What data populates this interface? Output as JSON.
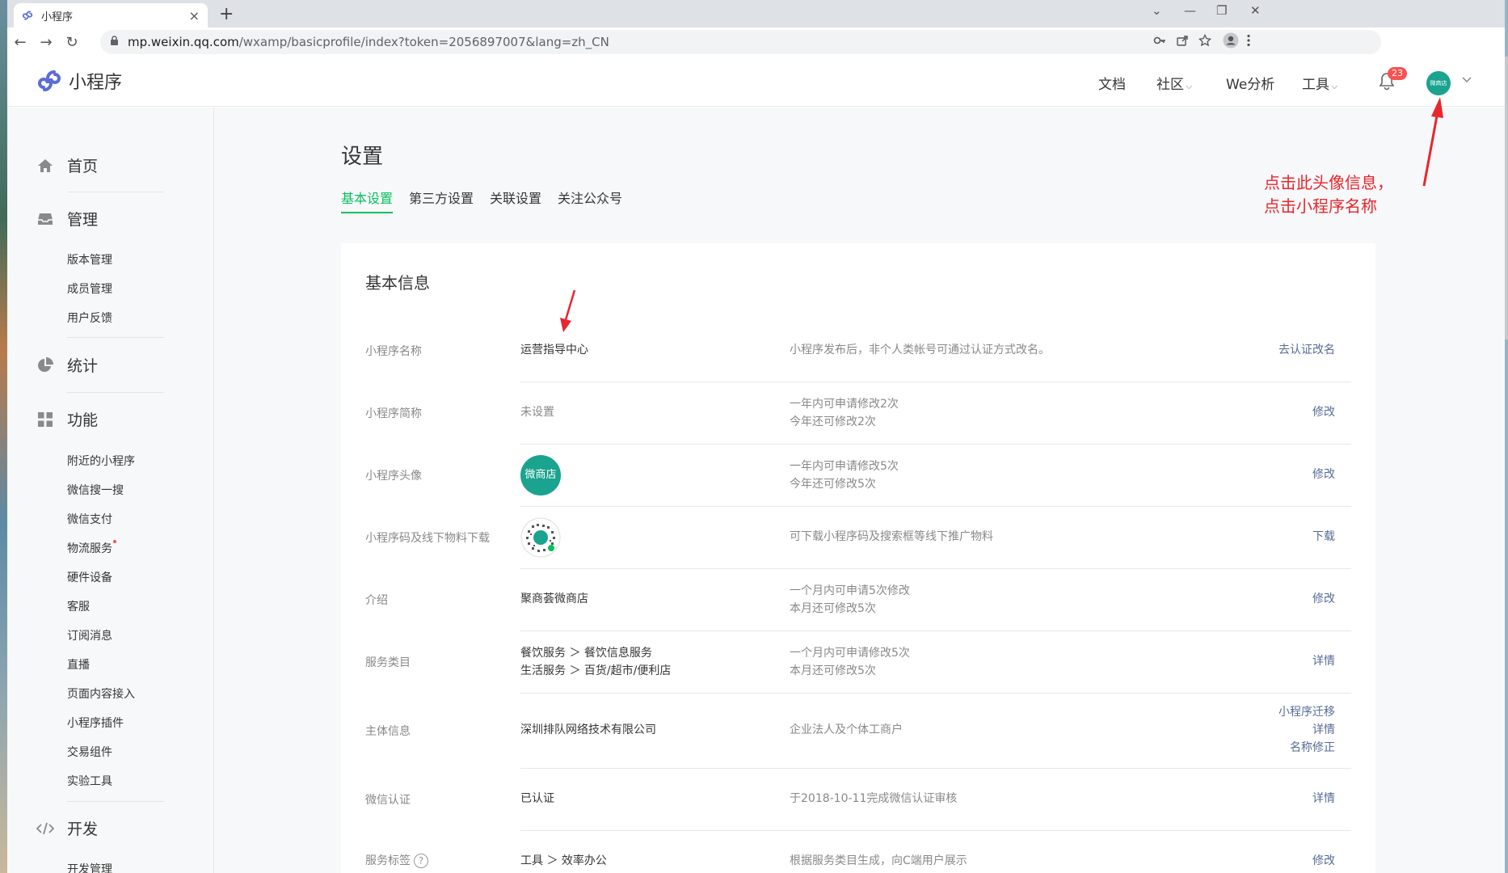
{
  "browser": {
    "tab_title": "小程序",
    "tab_close": "×",
    "new_tab": "+",
    "url_host": "mp.weixin.qq.com",
    "url_path": "/wxamp/basicprofile/index?token=2056897007&lang=zh_CN",
    "window_controls": [
      "⌄",
      "—",
      "❐",
      "✕"
    ],
    "nav": {
      "back": "←",
      "forward": "→",
      "reload": "↻"
    }
  },
  "header": {
    "logo_text": "小程序",
    "nav": [
      {
        "label": "文档"
      },
      {
        "label": "社区",
        "caret": "⌵"
      },
      {
        "label": "We分析"
      },
      {
        "label": "工具",
        "caret": "⌵"
      }
    ],
    "notification_count": "23",
    "avatar_text": "微商店"
  },
  "sidebar": {
    "sections": [
      {
        "label": "首页",
        "icon": "home-icon"
      },
      {
        "label": "管理",
        "icon": "inbox-icon",
        "items": [
          "版本管理",
          "成员管理",
          "用户反馈"
        ]
      },
      {
        "label": "统计",
        "icon": "pie-chart-icon"
      },
      {
        "label": "功能",
        "icon": "grid-icon",
        "items": [
          "附近的小程序",
          "微信搜一搜",
          "微信支付",
          "物流服务",
          "硬件设备",
          "客服",
          "订阅消息",
          "直播",
          "页面内容接入",
          "小程序插件",
          "交易组件",
          "实验工具"
        ]
      },
      {
        "label": "开发",
        "icon": "code-icon",
        "items": [
          "开发管理"
        ]
      }
    ]
  },
  "main": {
    "title": "设置",
    "tabs": [
      {
        "label": "基本设置",
        "active": true
      },
      {
        "label": "第三方设置"
      },
      {
        "label": "关联设置"
      },
      {
        "label": "关注公众号"
      }
    ],
    "card_title": "基本信息",
    "rows": [
      {
        "label": "小程序名称",
        "value": "运营指导中心",
        "desc": [
          "小程序发布后，非个人类帐号可通过认证方式改名。"
        ],
        "actions": [
          "去认证改名"
        ]
      },
      {
        "label": "小程序简称",
        "value": "未设置",
        "desc": [
          "一年内可申请修改2次",
          "今年还可修改2次"
        ],
        "actions": [
          "修改"
        ]
      },
      {
        "label": "小程序头像",
        "value_avatar": "微商店",
        "desc": [
          "一年内可申请修改5次",
          "今年还可修改5次"
        ],
        "actions": [
          "修改"
        ]
      },
      {
        "label": "小程序码及线下物料下载",
        "desc": [
          "可下载小程序码及搜索框等线下推广物料"
        ],
        "actions": [
          "下载"
        ]
      },
      {
        "label": "介绍",
        "value": "聚商荟微商店",
        "desc": [
          "一个月内可申请5次修改",
          "本月还可修改5次"
        ],
        "actions": [
          "修改"
        ]
      },
      {
        "label": "服务类目",
        "value_lines": [
          "餐饮服务 ＞ 餐饮信息服务",
          "生活服务 ＞ 百货/超市/便利店"
        ],
        "desc": [
          "一个月内可申请修改5次",
          "本月还可修改5次"
        ],
        "actions": [
          "详情"
        ]
      },
      {
        "label": "主体信息",
        "value": "深圳排队网络技术有限公司",
        "desc": [
          "企业法人及个体工商户"
        ],
        "actions": [
          "小程序迁移",
          "详情",
          "名称修正"
        ]
      },
      {
        "label": "微信认证",
        "value": "已认证",
        "desc": [
          "于2018-10-11完成微信认证审核"
        ],
        "actions": [
          "详情"
        ]
      },
      {
        "label": "服务标签",
        "value": "工具 ＞ 效率办公",
        "desc": [
          "根据服务类目生成，向C端用户展示"
        ],
        "actions": [
          "修改"
        ]
      }
    ]
  },
  "annotation": {
    "lines": [
      "点击此头像信息，",
      "点击小程序名称"
    ],
    "color": "#e8262d"
  },
  "colors": {
    "accent": "#07c160",
    "link": "#576b95",
    "badge": "#fa5151",
    "avatar": "#1aa38f"
  }
}
